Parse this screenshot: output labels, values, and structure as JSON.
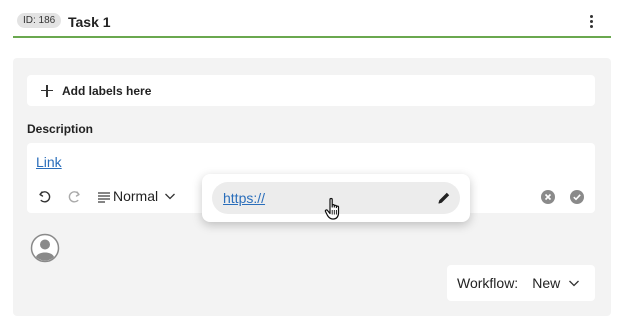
{
  "header": {
    "id_badge": "ID: 186",
    "title": "Task 1",
    "more_icon": "more-vertical-icon"
  },
  "labels": {
    "add_text": "Add labels here",
    "icon": "plus-icon"
  },
  "description": {
    "label": "Description",
    "link_text": "Link",
    "toolbar": {
      "undo_icon": "undo-icon",
      "redo_icon": "redo-icon",
      "paragraph_icon": "paragraph-lines-icon",
      "format_value": "Normal",
      "cancel_icon": "cancel-circle-icon",
      "confirm_icon": "check-circle-icon"
    }
  },
  "link_popup": {
    "url_value": "https://",
    "edit_icon": "pencil-icon"
  },
  "workflow": {
    "label": "Workflow:",
    "value": "New"
  },
  "colors": {
    "accent_green": "#6aa84f",
    "link_blue": "#2a6ebb",
    "panel_bg": "#f3f3f3"
  }
}
